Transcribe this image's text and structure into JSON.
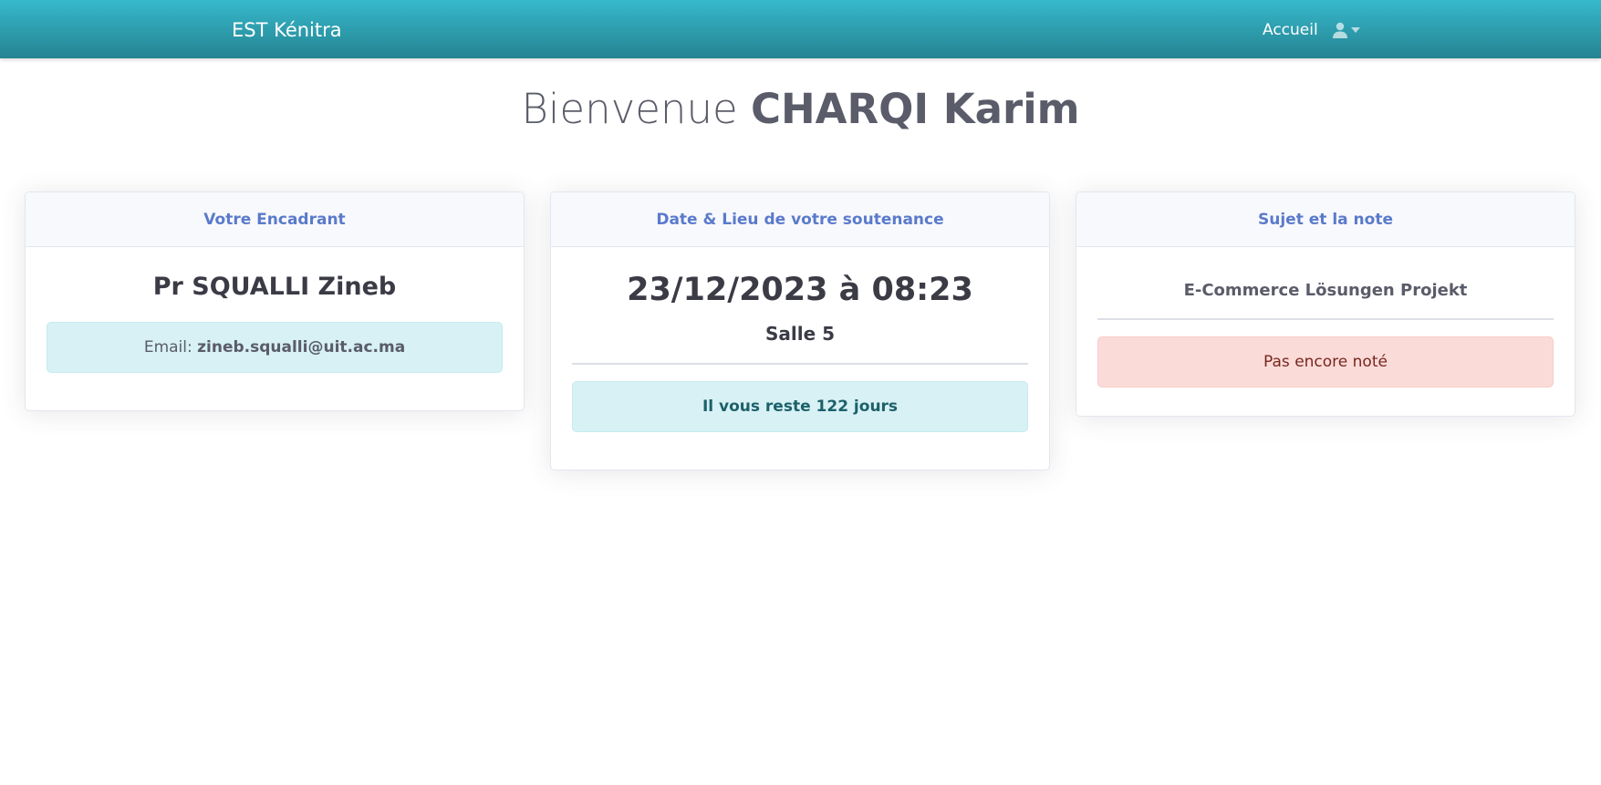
{
  "navbar": {
    "brand": "EST Kénitra",
    "home_link": "Accueil",
    "user_icon": "user-icon",
    "caret_icon": "caret-down-icon"
  },
  "welcome": {
    "prefix": "Bienvenue",
    "name": "CHARQI Karim"
  },
  "cards": {
    "encadrant": {
      "header": "Votre Encadrant",
      "name": "Pr SQUALLI Zineb",
      "email_label": "Email:",
      "email_value": "zineb.squalli@uit.ac.ma"
    },
    "soutenance": {
      "header": "Date & Lieu de votre soutenance",
      "date": "23/12/2023 à 08:23",
      "salle": "Salle 5",
      "remaining": "Il vous reste 122 jours"
    },
    "sujet": {
      "header": "Sujet et la note",
      "title": "E-Commerce Lösungen Projekt",
      "note_status": "Pas encore noté"
    }
  },
  "colors": {
    "navbar_top": "#36b9cc",
    "navbar_bottom": "#258391",
    "card_header_text": "#5a7acb",
    "info_bg": "#d7f1f5",
    "danger_bg": "#fadbd8"
  }
}
